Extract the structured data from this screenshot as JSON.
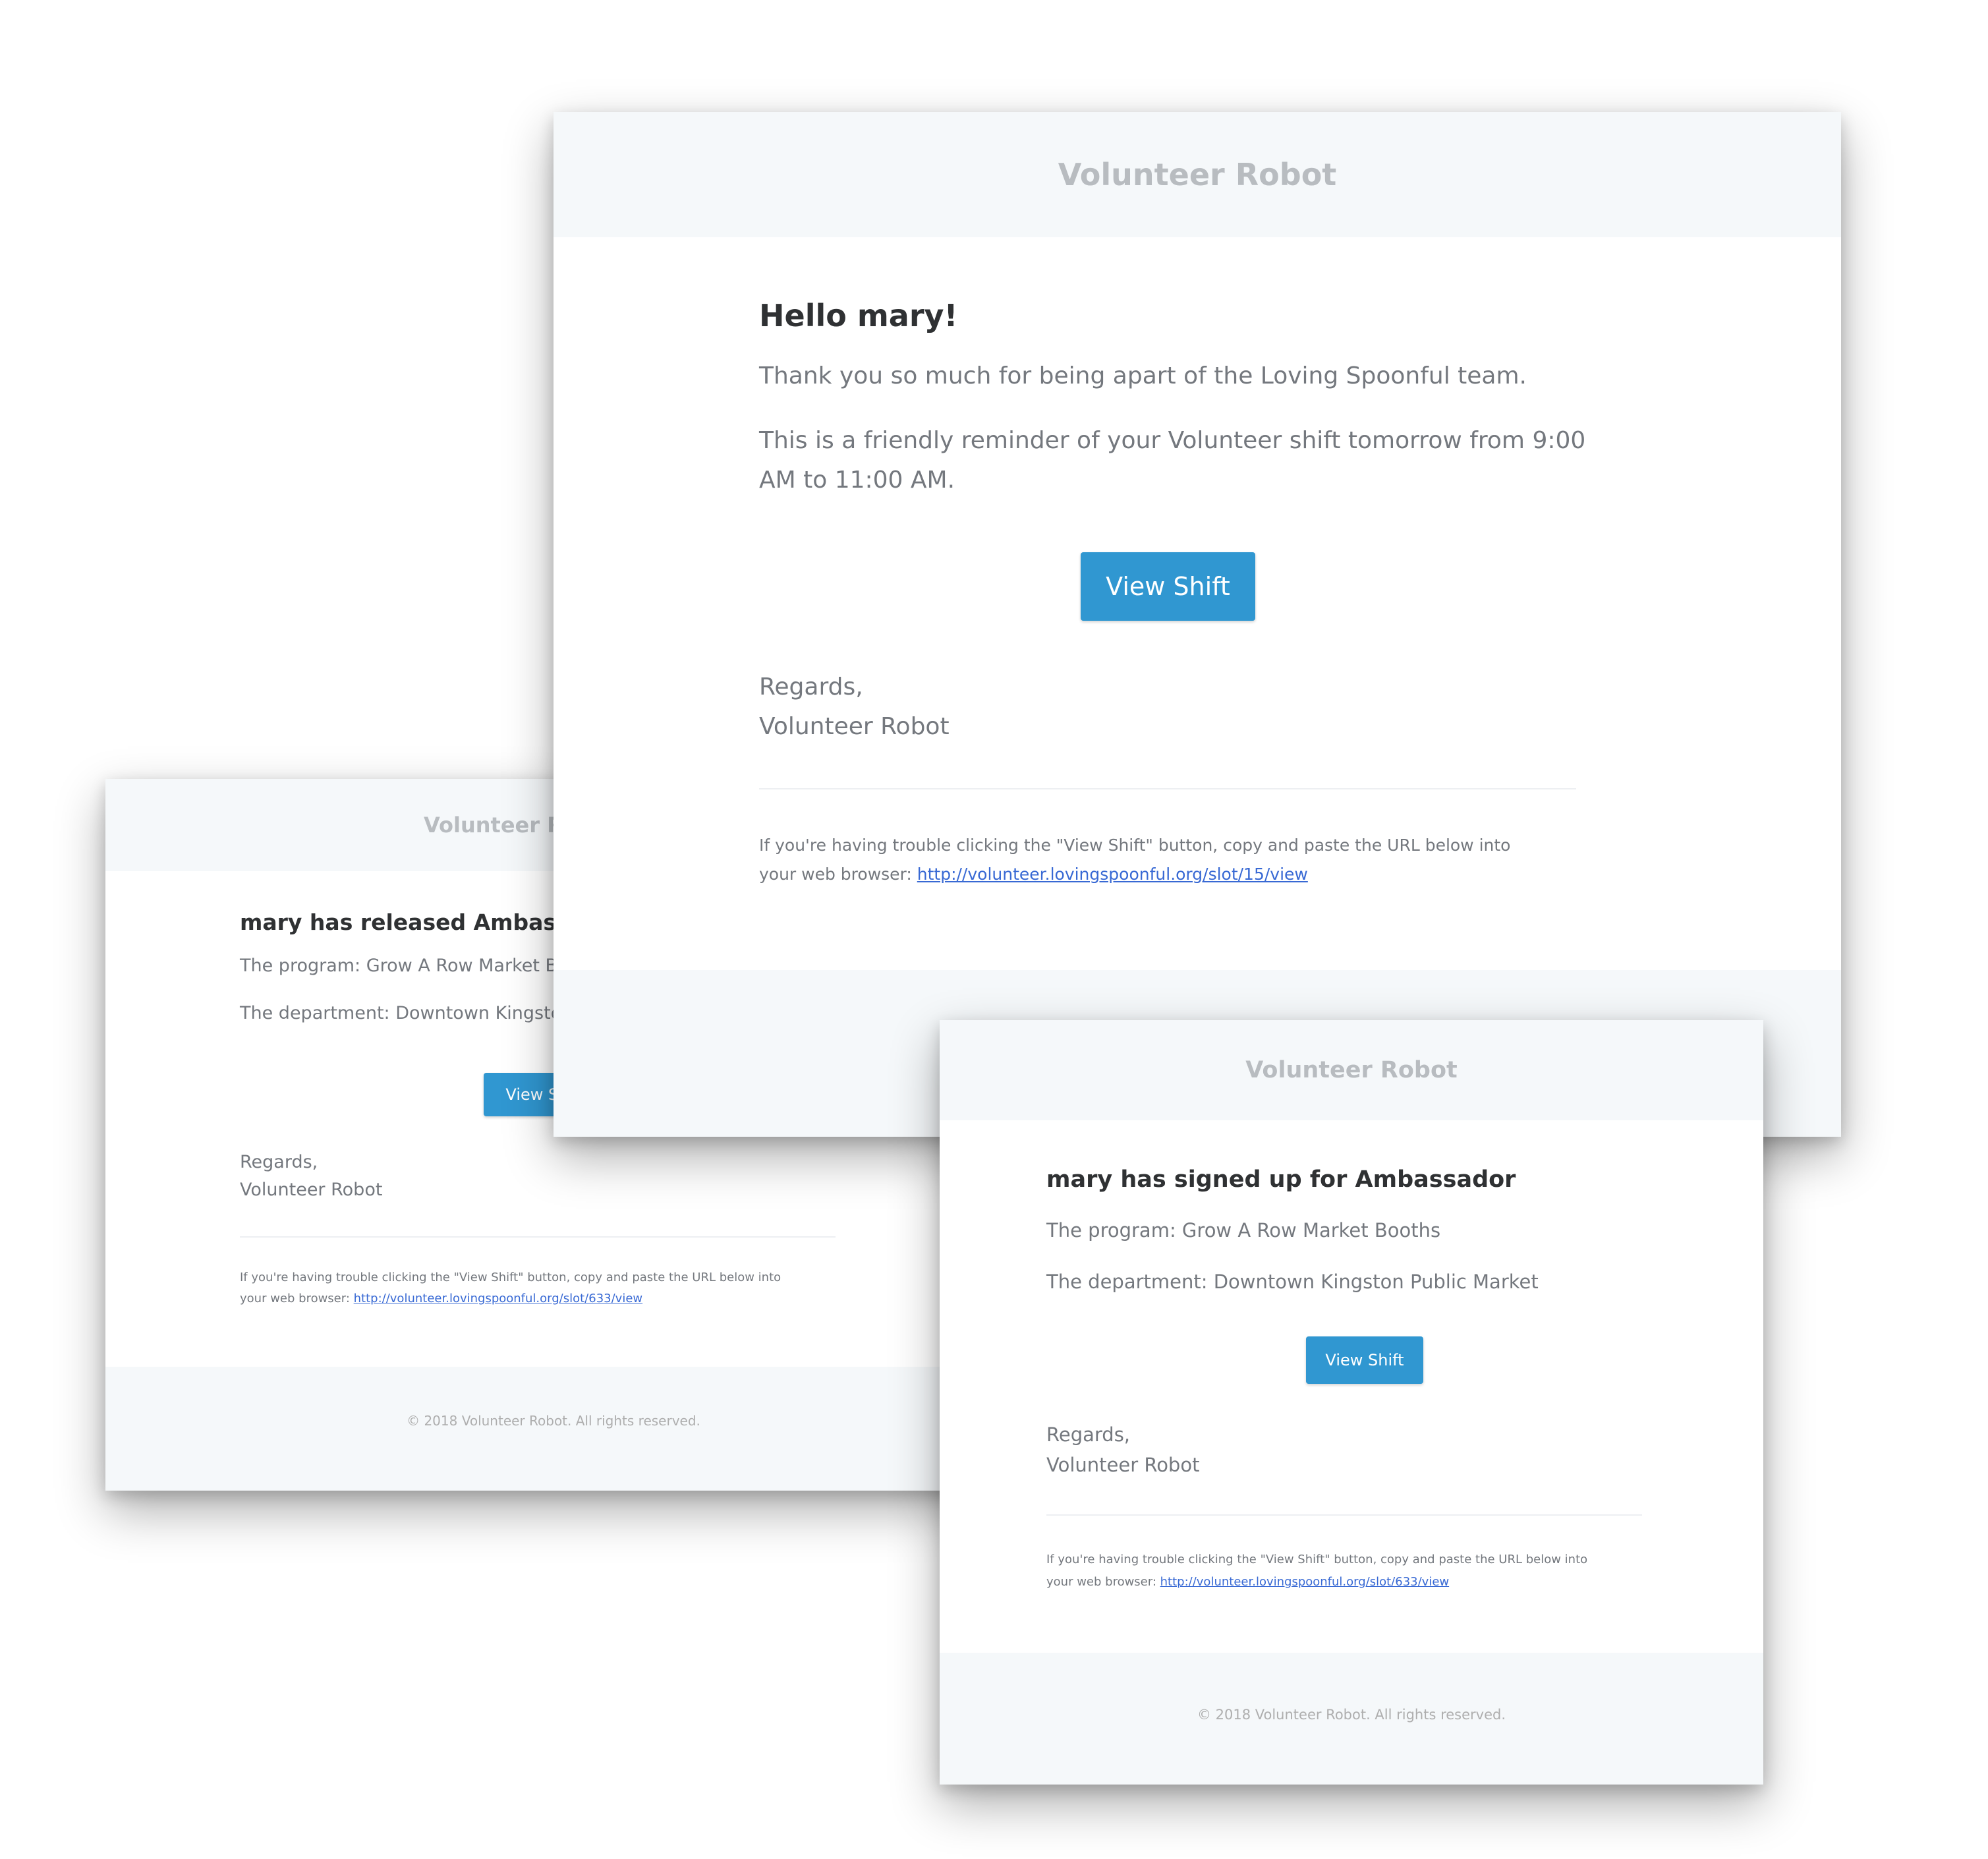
{
  "email_released": {
    "brand": "Volunteer Robot",
    "heading": "mary has released Ambassador",
    "program": "The program: Grow A Row Market Booths",
    "department": "The department: Downtown Kingston Public Market",
    "button_label": "View Shift",
    "regards": "Regards,",
    "signature": "Volunteer Robot",
    "trouble_text_1": "If you're having trouble clicking the \"View Shift\" button, copy and paste the URL below into",
    "trouble_text_2": "your web browser:",
    "url": "http://volunteer.lovingspoonful.org/slot/633/view",
    "copyright": "© 2018 Volunteer Robot. All rights reserved."
  },
  "email_reminder": {
    "brand": "Volunteer Robot",
    "greeting": "Hello mary!",
    "thanks": "Thank you so much for being apart of the Loving Spoonful team.",
    "reminder_1": "This is a friendly reminder of your Volunteer shift tomorrow from 9:00",
    "reminder_2": "AM to 11:00 AM.",
    "button_label": "View Shift",
    "regards": "Regards,",
    "signature": "Volunteer Robot",
    "trouble_text_1": "If you're having trouble clicking the \"View Shift\" button, copy and paste the URL below into",
    "trouble_text_2": "your web browser:",
    "url": "http://volunteer.lovingspoonful.org/slot/15/view"
  },
  "email_signed_up": {
    "brand": "Volunteer Robot",
    "heading": "mary has signed up for Ambassador",
    "program": "The program: Grow A Row Market Booths",
    "department": "The department: Downtown Kingston Public Market",
    "button_label": "View Shift",
    "regards": "Regards,",
    "signature": "Volunteer Robot",
    "trouble_text_1": "If you're having trouble clicking the \"View Shift\" button, copy and paste the URL below into",
    "trouble_text_2": "your web browser:",
    "url": "http://volunteer.lovingspoonful.org/slot/633/view",
    "copyright": "© 2018 Volunteer Robot. All rights reserved."
  },
  "colors": {
    "button": "#3097d1",
    "header_background": "#f5f8fa",
    "link": "#3869d4",
    "heading_text": "#2f3133",
    "body_text": "#74787e"
  }
}
